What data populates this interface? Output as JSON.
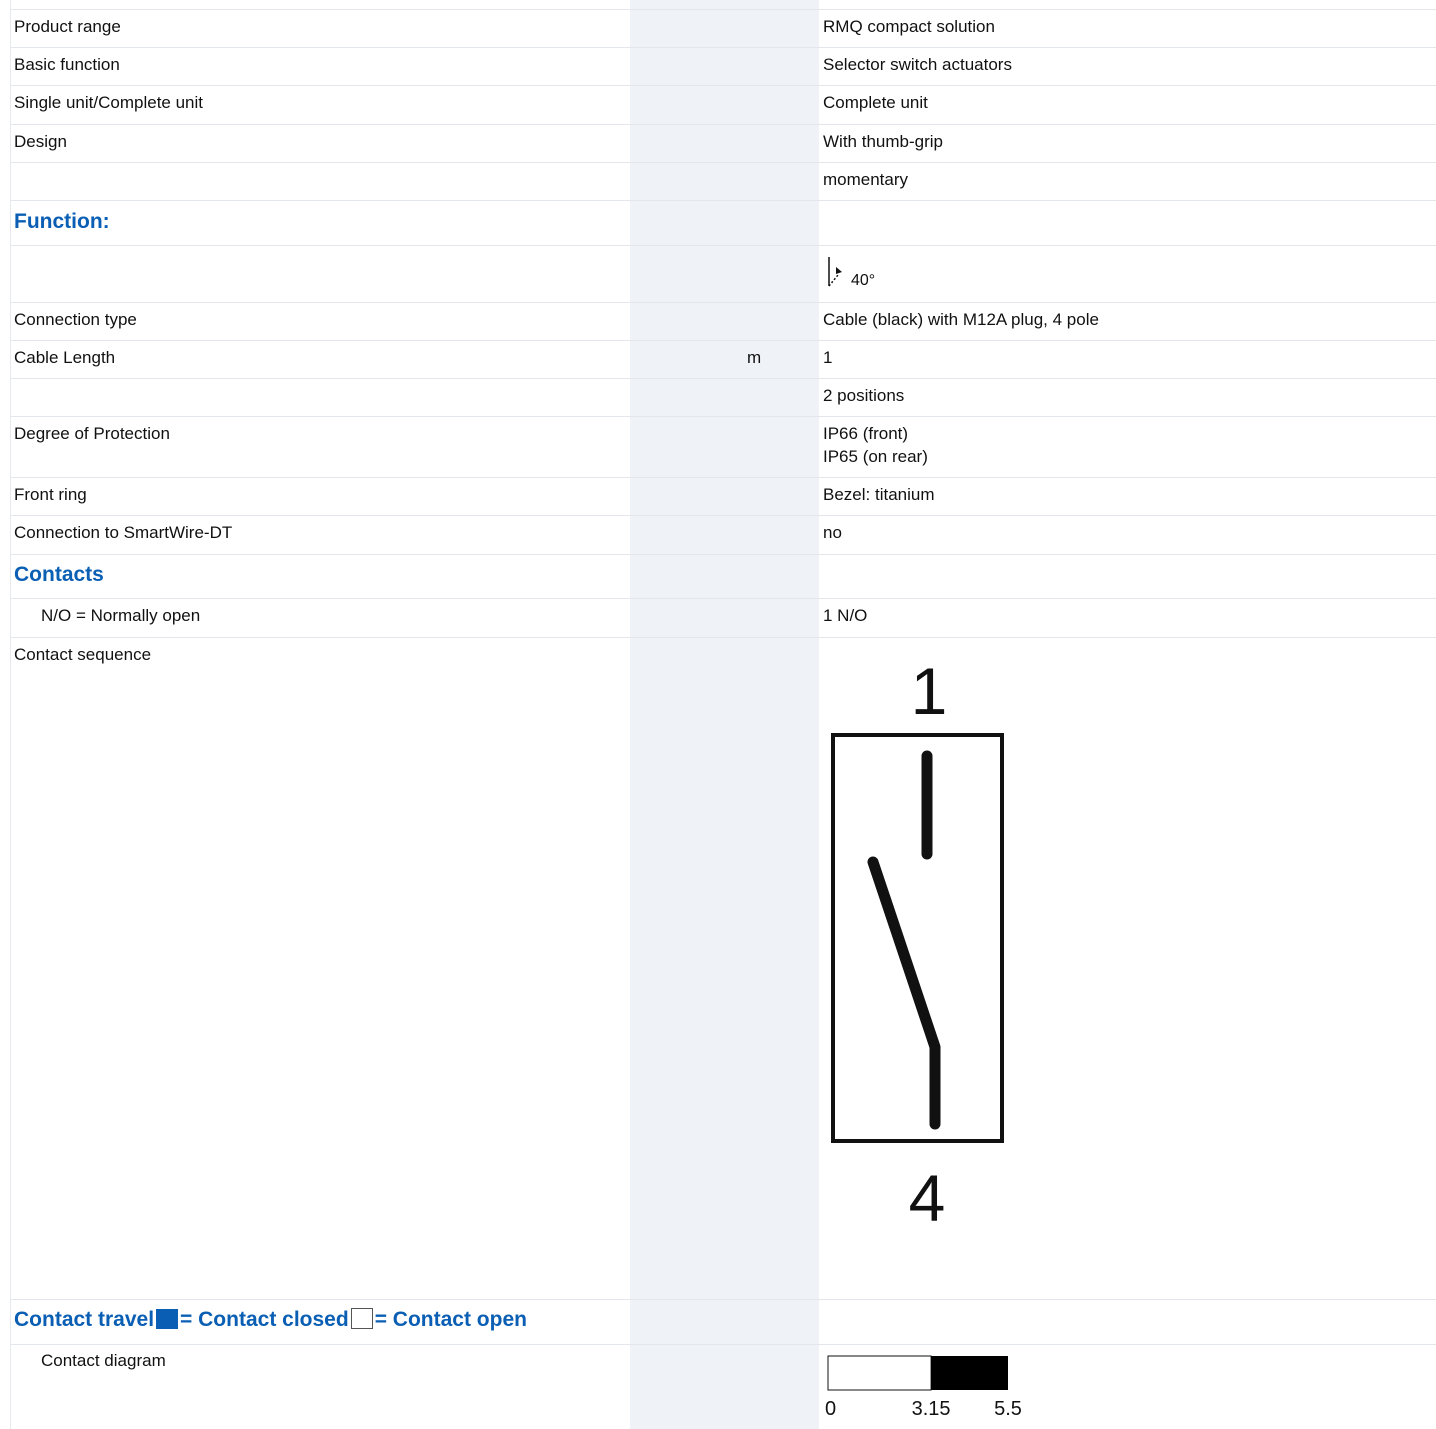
{
  "rows": [
    {
      "label": "Product range",
      "unit": "",
      "value": "RMQ compact solution"
    },
    {
      "label": "Basic function",
      "unit": "",
      "value": "Selector switch actuators"
    },
    {
      "label": "Single unit/Complete unit",
      "unit": "",
      "value": "Complete unit"
    },
    {
      "label": "Design",
      "unit": "",
      "value": "With thumb-grip"
    },
    {
      "label": "",
      "unit": "",
      "value": "momentary"
    },
    {
      "label": "Function:"
    },
    {
      "label": "",
      "unit": "",
      "value": "40°"
    },
    {
      "label": "Connection type",
      "unit": "",
      "value": "Cable (black) with M12A plug, 4 pole"
    },
    {
      "label": "Cable Length",
      "unit": "m",
      "value": "1"
    },
    {
      "label": "",
      "unit": "",
      "value": "2 positions"
    },
    {
      "label": "Degree of Protection",
      "unit": "",
      "value": "IP66 (front)",
      "value2": "IP65 (on rear)"
    },
    {
      "label": "Front ring",
      "unit": "",
      "value": "Bezel: titanium"
    },
    {
      "label": "Connection to SmartWire-DT",
      "unit": "",
      "value": "no"
    },
    {
      "label": "Contacts"
    },
    {
      "label": "N/O = Normally open",
      "unit": "",
      "value": "1 N/O"
    },
    {
      "label": "Contact sequence",
      "unit": ""
    },
    {
      "label": "Contact diagram",
      "unit": ""
    }
  ],
  "contact_sequence": {
    "top_number": "1",
    "bottom_number": "4"
  },
  "legend": {
    "prefix": "Contact travel",
    "closed": "= Contact closed",
    "open": "= Contact open"
  },
  "contact_diagram": {
    "ticks": [
      "0",
      "3.15",
      "5.5"
    ],
    "open_from": 0,
    "closed_from": 3.15,
    "end": 5.5
  }
}
